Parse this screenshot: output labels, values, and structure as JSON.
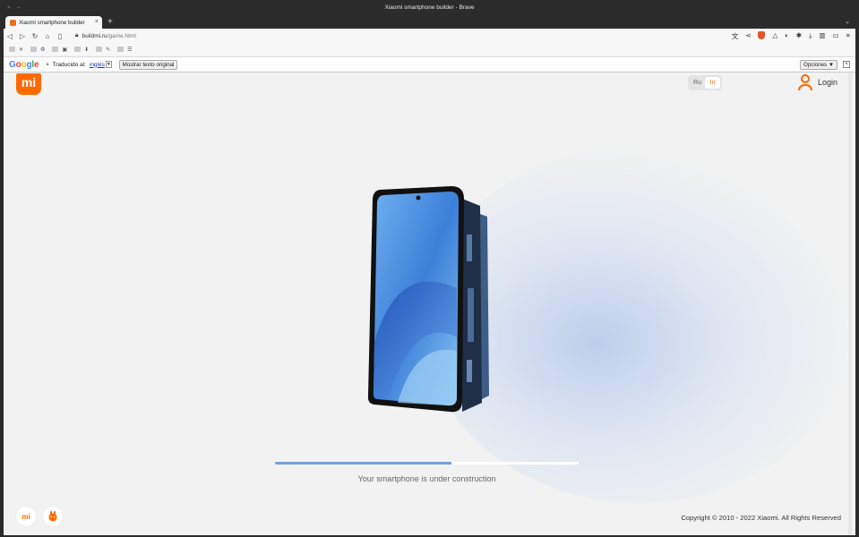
{
  "browser": {
    "window_title": "Xiaomi smartphone builder - Brave",
    "tab_title": "Xiaomi smartphone builder",
    "url_domain": "buildmi.ru",
    "url_path": "/game.html"
  },
  "translate_bar": {
    "logo": [
      "G",
      "o",
      "o",
      "g",
      "l",
      "e"
    ],
    "label": "Traducido al:",
    "language": "inglés",
    "show_original": "Mostrar texto original",
    "options": "Opciones ▼"
  },
  "page": {
    "logo": "mi",
    "lang_ru": "Ru",
    "lang_en": "In",
    "login": "Login",
    "progress_fraction": 0.58,
    "status": "Your smartphone is under construction",
    "copyright": "Copyright © 2010 - 2022 Xiaomi. All Rights Reserved",
    "footer_mi": "mi"
  },
  "colors": {
    "accent": "#ff6900",
    "progress": "#7a9fd4"
  }
}
